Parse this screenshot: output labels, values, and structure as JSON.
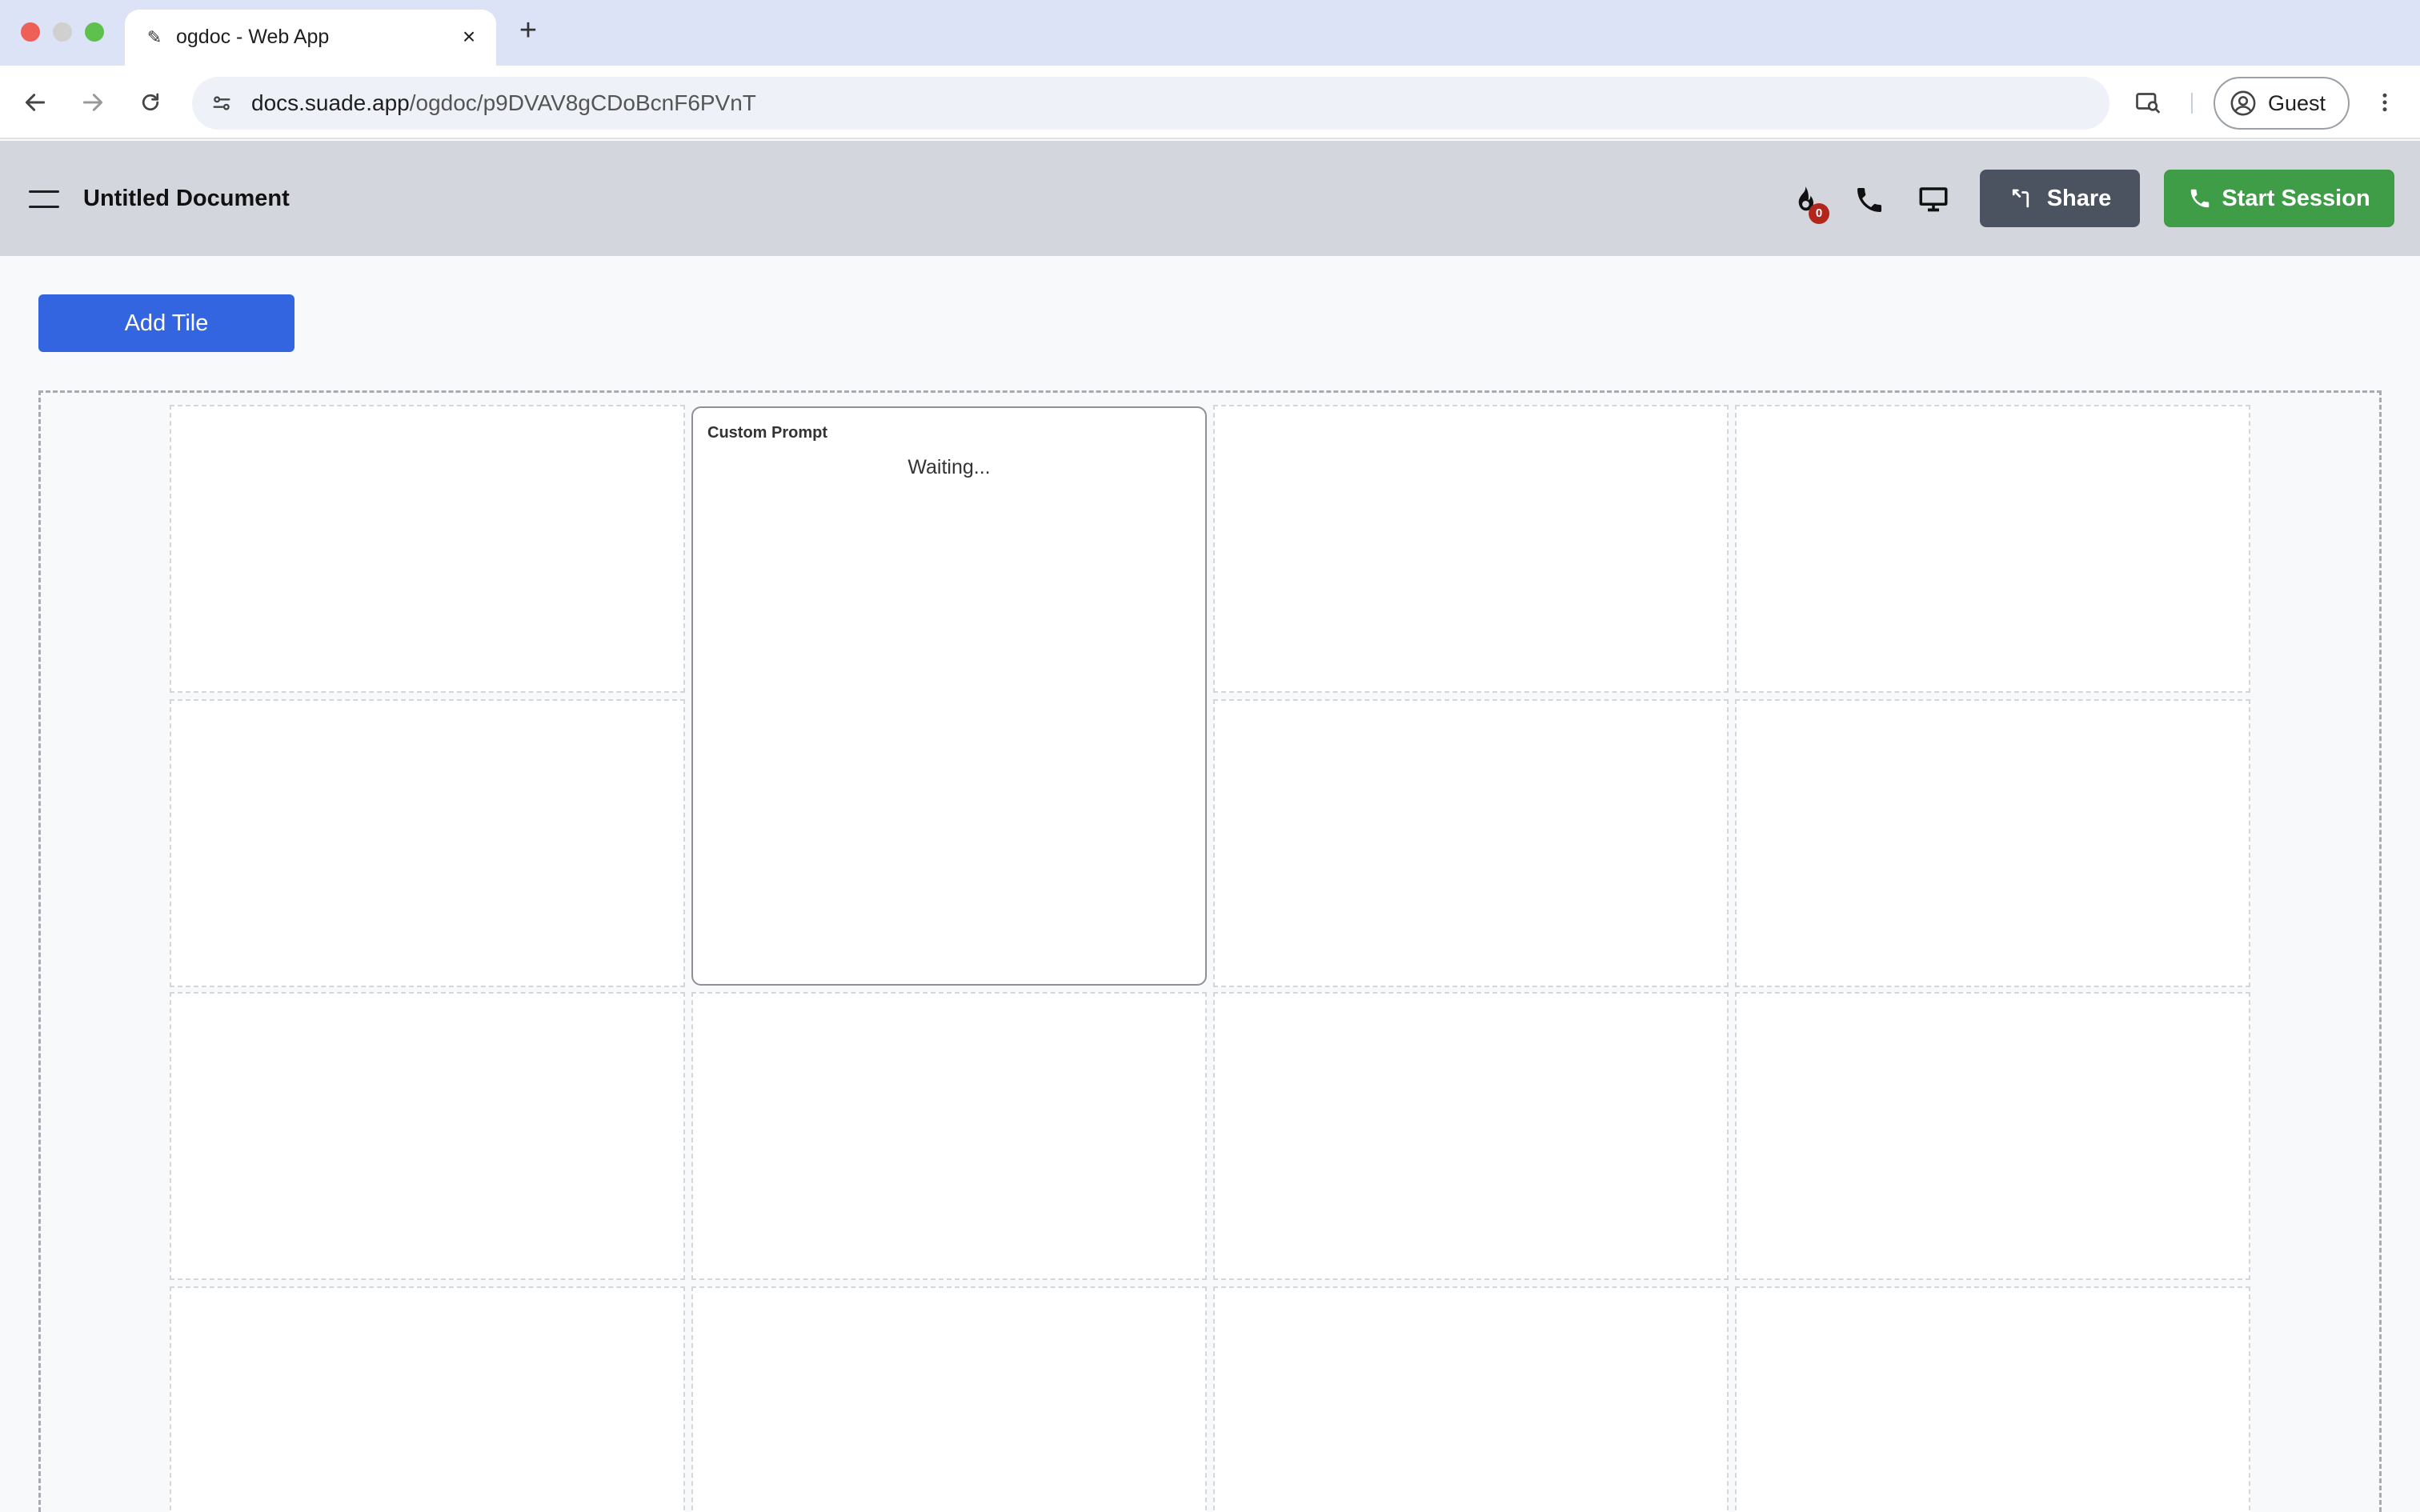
{
  "browser": {
    "tab_title": "ogdoc - Web App",
    "url_host": "docs.suade.app",
    "url_path": "/ogdoc/p9DVAV8gCDoBcnF6PVnT",
    "profile_label": "Guest"
  },
  "app": {
    "document_title": "Untitled Document",
    "fire_count": "0",
    "share_label": "Share",
    "start_session_label": "Start Session",
    "add_tile_label": "Add Tile"
  },
  "tile": {
    "title": "Custom Prompt",
    "status": "Waiting..."
  },
  "colors": {
    "tabstrip": "#dde3f6",
    "header": "#d3d7dd",
    "share_button": "#4b5360",
    "start_session_button": "#3f9c47",
    "add_tile_button": "#3465e0",
    "badge": "#b3261e"
  },
  "icons": [
    "back-arrow-icon",
    "forward-arrow-icon",
    "reload-icon",
    "site-info-icon",
    "lens-icon",
    "profile-icon",
    "more-vert-icon",
    "hamburger-icon",
    "fire-icon",
    "phone-icon",
    "monitor-icon",
    "share-icon"
  ]
}
